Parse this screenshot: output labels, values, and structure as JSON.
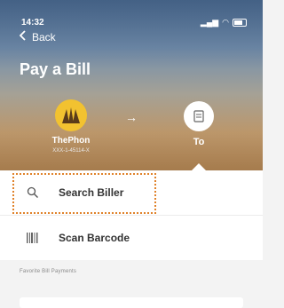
{
  "status_bar": {
    "time": "14:32"
  },
  "nav": {
    "back_label": "Back"
  },
  "page": {
    "title": "Pay a Bill"
  },
  "from": {
    "name": "ThePhon",
    "account": "XXX-1-45114-X"
  },
  "to": {
    "label": "To"
  },
  "options": [
    {
      "label": "Search Biller",
      "icon": "search-icon"
    },
    {
      "label": "Scan Barcode",
      "icon": "barcode-icon"
    }
  ],
  "favorites": {
    "heading": "Favorite Bill Payments"
  },
  "colors": {
    "logo_yellow": "#f2c230",
    "highlight_orange": "#e0822a"
  }
}
